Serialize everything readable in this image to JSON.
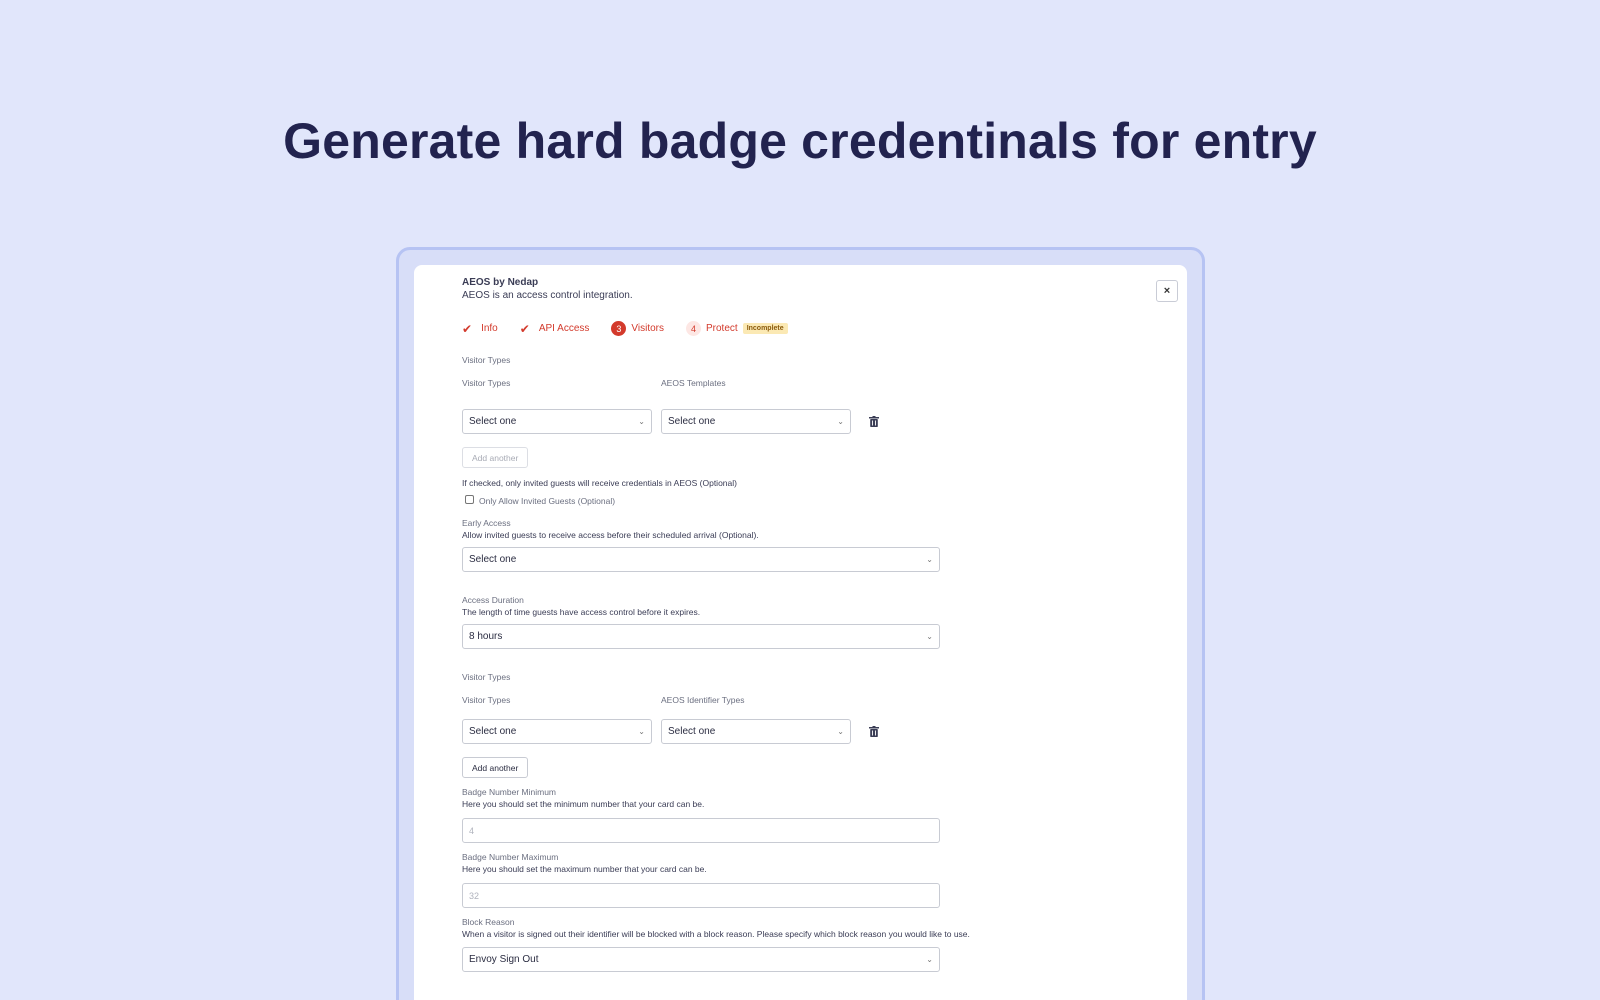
{
  "hero": {
    "title": "Generate hard badge credentinals for entry"
  },
  "header": {
    "app_name": "AEOS by Nedap",
    "app_description": "AEOS is an access control integration.",
    "close_label": "×"
  },
  "steps": [
    {
      "marker": "✔",
      "label": "Info",
      "state": "complete"
    },
    {
      "marker": "✔",
      "label": "API Access",
      "state": "complete"
    },
    {
      "marker": "3",
      "label": "Visitors",
      "state": "current"
    },
    {
      "marker": "4",
      "label": "Protect",
      "state": "pending",
      "badge": "Incomplete"
    }
  ],
  "visitor_templates": {
    "section_title": "Visitor Types",
    "col1_label": "Visitor Types",
    "col2_label": "AEOS Templates",
    "col1_value": "Select one",
    "col2_value": "Select one",
    "add_label": "Add another"
  },
  "invited_only": {
    "description": "If checked, only invited guests will receive credentials in AEOS (Optional)",
    "checkbox_label": "Only Allow Invited Guests (Optional)",
    "checked": false
  },
  "early_access": {
    "label": "Early Access",
    "description": "Allow invited guests to receive access before their scheduled arrival (Optional).",
    "value": "Select one"
  },
  "access_duration": {
    "label": "Access Duration",
    "description": "The length of time guests have access control before it expires.",
    "value": "8 hours"
  },
  "visitor_identifiers": {
    "section_title": "Visitor Types",
    "col1_label": "Visitor Types",
    "col2_label": "AEOS Identifier Types",
    "col1_value": "Select one",
    "col2_value": "Select one",
    "add_label": "Add another"
  },
  "badge_min": {
    "label": "Badge Number Minimum",
    "description": "Here you should set the minimum number that your card can be.",
    "placeholder": "4"
  },
  "badge_max": {
    "label": "Badge Number Maximum",
    "description": "Here you should set the maximum number that your card can be.",
    "placeholder": "32"
  },
  "block_reason": {
    "label": "Block Reason",
    "description": "When a visitor is signed out their identifier will be blocked with a block reason. Please specify which block reason you would like to use.",
    "value": "Envoy Sign Out"
  },
  "icons": {
    "chevron": "chevron-down-icon",
    "trash": "trash-icon",
    "check": "check-icon"
  },
  "colors": {
    "accent": "#d33a2c",
    "background": "#e1e6fb",
    "title": "#22234f",
    "badge_bg": "#fbe9b4"
  }
}
